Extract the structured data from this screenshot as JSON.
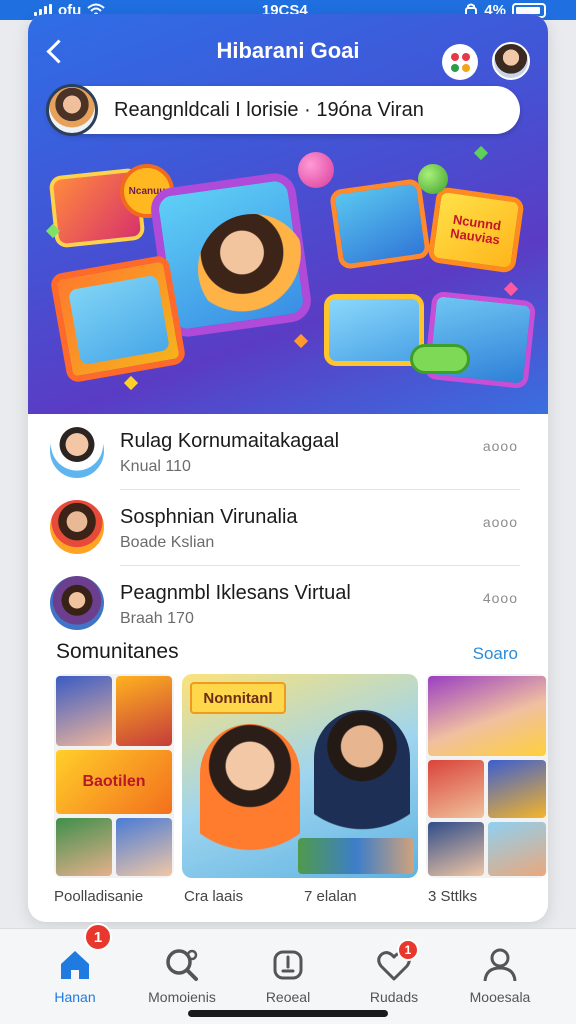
{
  "status_bar": {
    "carrier": "ofu",
    "time": "19CS4",
    "battery": "4%"
  },
  "header": {
    "title": "Hibarani Goai"
  },
  "search": {
    "text": "Reangnldcali I lorisie · 19óna Viran"
  },
  "scene_tiles": [
    {
      "text": "Ncanuu"
    },
    {
      "text": "Ncunnd Nauvias"
    }
  ],
  "list": [
    {
      "name": "Rulag Kornumaitakagaal",
      "sub": "Knual 110"
    },
    {
      "name": "Sosphnian Virunalia",
      "sub": "Boade Kslian"
    },
    {
      "name": "Peagnmbl Iklesans Virtual",
      "sub": "Braah 170"
    }
  ],
  "list_more_labels": [
    "aooo",
    "aooo",
    "4ooo"
  ],
  "section": {
    "title": "Somunitanes",
    "link": "Soaro"
  },
  "gallery_texts": {
    "tile1": "Baotilen",
    "tile2": "Nonnitanl"
  },
  "captions": [
    "Poolladisanie",
    "Cra laais",
    "7 elalan",
    "3 Sttlks"
  ],
  "tabs": [
    {
      "label": "Hanan",
      "icon": "home-icon",
      "active": true,
      "badge": "1"
    },
    {
      "label": "Momoienis",
      "icon": "search-icon",
      "active": false
    },
    {
      "label": "Reoeal",
      "icon": "reel-icon",
      "active": false
    },
    {
      "label": "Rudads",
      "icon": "heart-icon",
      "active": false,
      "badge": "1"
    },
    {
      "label": "Mooesala",
      "icon": "person-icon",
      "active": false
    }
  ],
  "colors": {
    "primary": "#1f7be0",
    "badge": "#e8372c",
    "link": "#2d8bd8"
  }
}
